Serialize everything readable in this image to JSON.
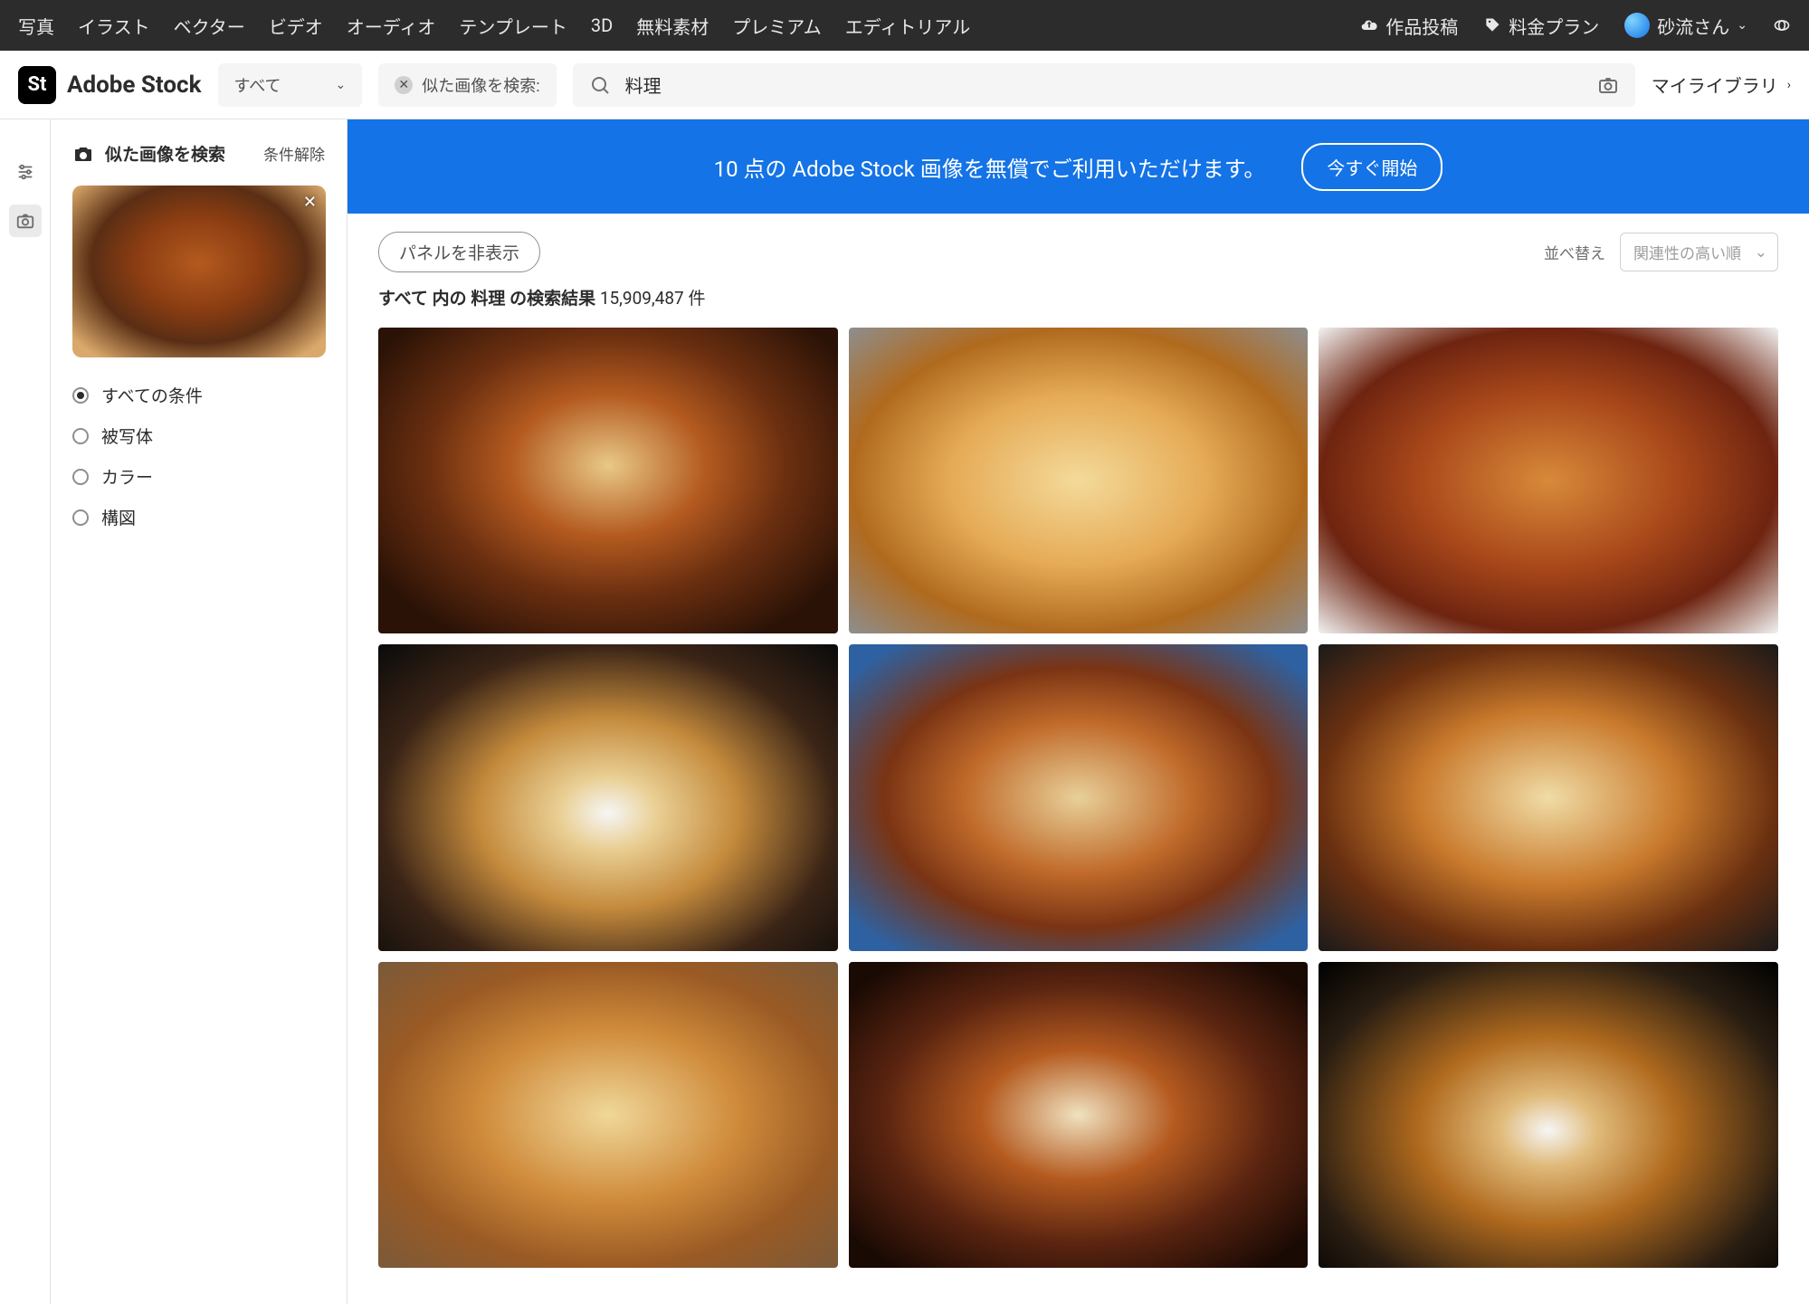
{
  "topnav": {
    "items": [
      "写真",
      "イラスト",
      "ベクター",
      "ビデオ",
      "オーディオ",
      "テンプレート",
      "3D",
      "無料素材",
      "プレミアム",
      "エディトリアル"
    ],
    "upload": "作品投稿",
    "pricing": "料金プラン",
    "user": "砂流さん"
  },
  "logo": "Adobe Stock",
  "search": {
    "scope": "すべて",
    "similar_label": "似た画像を検索:",
    "value": "料理",
    "mylibrary": "マイライブラリ"
  },
  "sidebar": {
    "title": "似た画像を検索",
    "clear": "条件解除",
    "options": [
      {
        "label": "すべての条件",
        "checked": true
      },
      {
        "label": "被写体",
        "checked": false
      },
      {
        "label": "カラー",
        "checked": false
      },
      {
        "label": "構図",
        "checked": false
      }
    ]
  },
  "banner": {
    "text": "10 点の Adobe Stock 画像を無償でご利用いただけます。",
    "cta": "今すぐ開始"
  },
  "controls": {
    "hide_panel": "パネルを非表示",
    "sort_label": "並べ替え",
    "sort_value": "関連性の高い順"
  },
  "results": {
    "prefix": "すべて 内の",
    "term": "料理",
    "mid": "の検索結果",
    "count": "15,909,487",
    "suffix": "件"
  }
}
